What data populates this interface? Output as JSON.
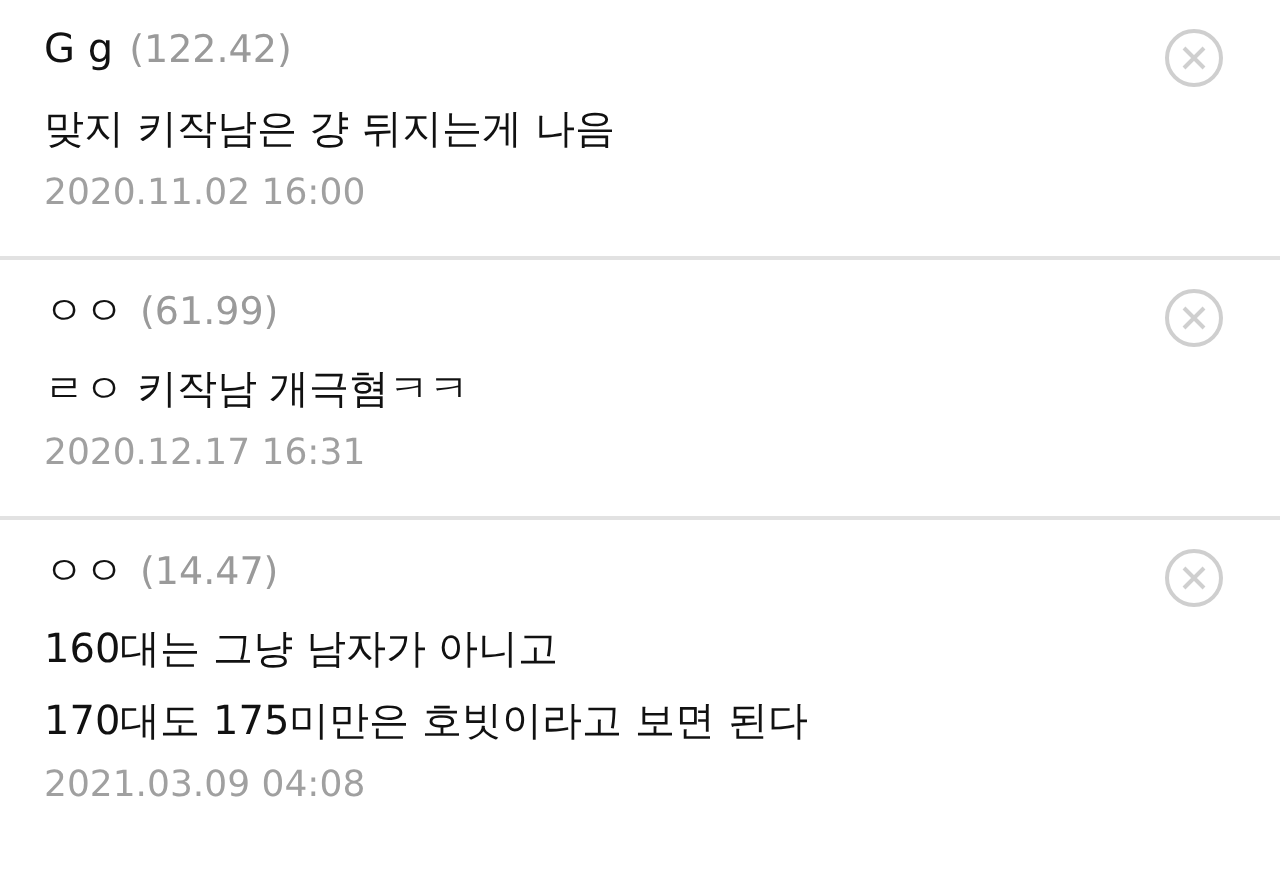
{
  "comments": [
    {
      "author": "G g",
      "score": "(122.42)",
      "text": "맞지 키작남은 걍 뒤지는게 나음",
      "date": "2020.11.02 16:00"
    },
    {
      "author": "ㅇㅇ",
      "score": "(61.99)",
      "text": "ㄹㅇ 키작남 개극혐ㅋㅋ",
      "date": "2020.12.17 16:31"
    },
    {
      "author": "ㅇㅇ",
      "score": "(14.47)",
      "text": "160대는 그냥 남자가 아니고\n170대도 175미만은 호빗이라고 보면 된다",
      "date": "2021.03.09 04:08"
    }
  ]
}
